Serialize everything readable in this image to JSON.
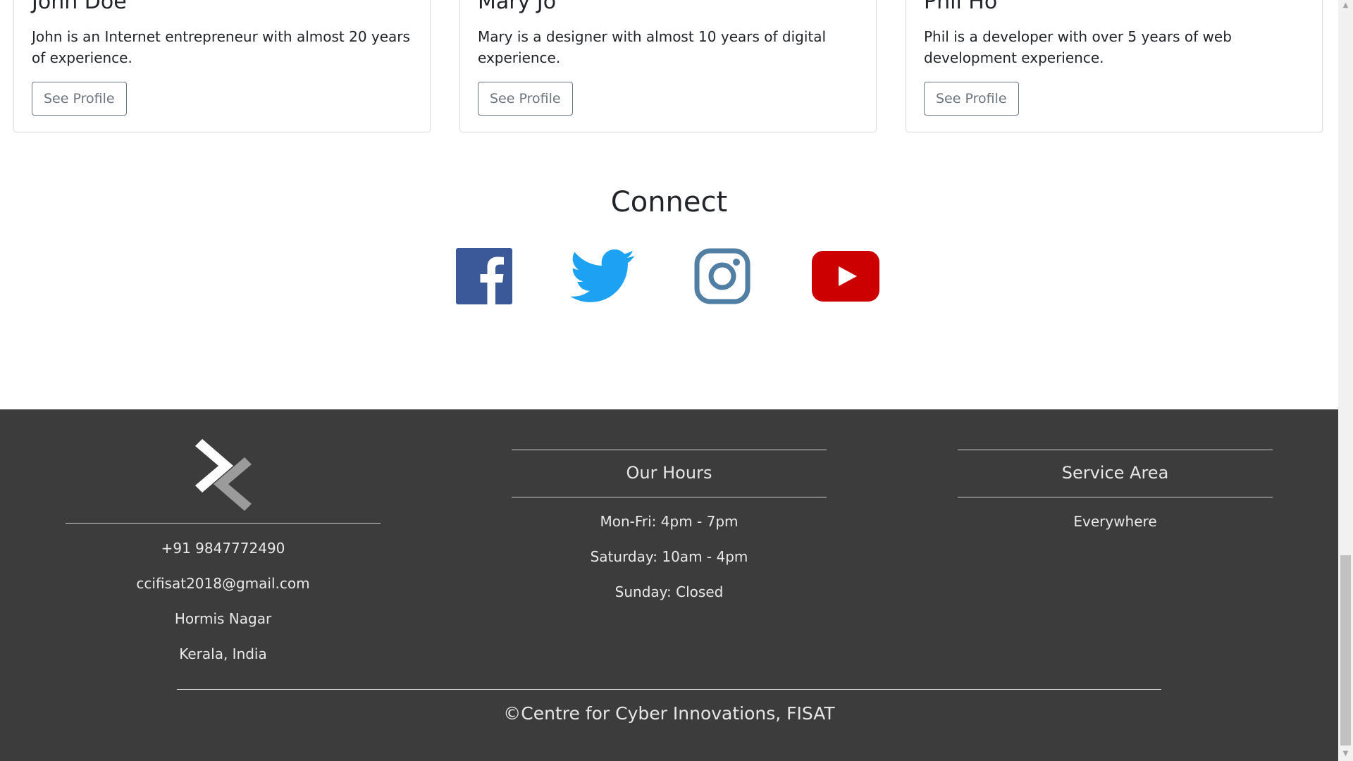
{
  "team": [
    {
      "name": "John Doe",
      "description": "John is an Internet entrepreneur with almost 20 years of experience.",
      "button": "See Profile"
    },
    {
      "name": "Mary Jo",
      "description": "Mary is a designer with almost 10 years of digital experience.",
      "button": "See Profile"
    },
    {
      "name": "Phil Ho",
      "description": "Phil is a developer with over 5 years of web development experience.",
      "button": "See Profile"
    }
  ],
  "connect": {
    "title": "Connect",
    "icons": [
      "facebook-icon",
      "twitter-icon",
      "instagram-icon",
      "youtube-icon"
    ]
  },
  "footer": {
    "contact": {
      "phone": "+91 9847772490",
      "email": "ccifisat2018@gmail.com",
      "address1": "Hormis Nagar",
      "address2": "Kerala, India"
    },
    "hours": {
      "title": "Our Hours",
      "lines": [
        "Mon-Fri: 4pm - 7pm",
        "Saturday: 10am - 4pm",
        "Sunday: Closed"
      ]
    },
    "service": {
      "title": "Service Area",
      "lines": [
        "Everywhere"
      ]
    },
    "copyright": "©Centre for Cyber Innovations, FISAT"
  },
  "colors": {
    "footer_bg": "#3c3c3d",
    "facebook": "#3b5998",
    "twitter": "#1da1f2",
    "instagram": "#517fa4",
    "youtube": "#cc0000"
  }
}
